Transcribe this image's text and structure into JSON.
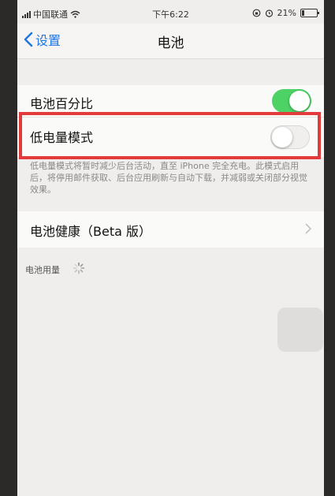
{
  "status_bar": {
    "carrier": "中国联通",
    "time": "下午6:22",
    "battery_percent": "21%",
    "battery_level": 0.21
  },
  "nav": {
    "back_label": "设置",
    "title": "电池"
  },
  "settings": {
    "battery_percentage": {
      "label": "电池百分比",
      "enabled": true
    },
    "low_power_mode": {
      "label": "低电量模式",
      "enabled": false
    },
    "low_power_description": "低电量模式将暂时减少后台活动，直至 iPhone 完全充电。此模式启用后，将停用邮件获取、后台应用刷新与自动下载，并减弱或关闭部分视觉效果。",
    "battery_health": {
      "label": "电池健康（Beta 版）"
    },
    "usage_section_label": "电池用量"
  },
  "colors": {
    "accent_blue": "#1f76e3",
    "toggle_on": "#4cd265",
    "highlight_red": "#e33b3b"
  },
  "icons": [
    "signal-icon",
    "wifi-icon",
    "lock-rotation-icon",
    "alarm-icon",
    "battery-icon",
    "chevron-left-icon",
    "chevron-right-icon",
    "loading-spinner-icon"
  ]
}
